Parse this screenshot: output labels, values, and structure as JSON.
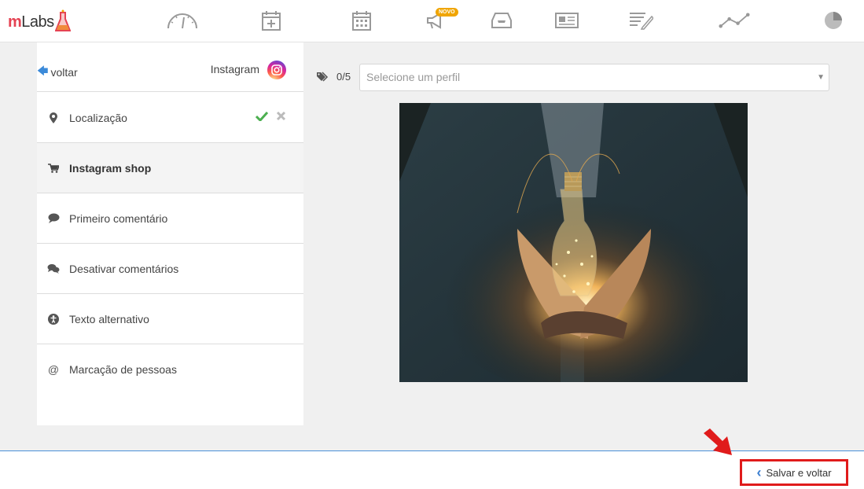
{
  "app": {
    "logo_text": "mLabs"
  },
  "nav": {
    "items": [
      {
        "icon": "speedometer-icon"
      },
      {
        "icon": "calendar-add-icon"
      },
      {
        "icon": "calendar-icon"
      },
      {
        "icon": "megaphone-icon",
        "badge": "NOVO"
      },
      {
        "icon": "inbox-icon"
      },
      {
        "icon": "newspaper-icon"
      },
      {
        "icon": "edit-list-icon"
      },
      {
        "icon": "line-chart-icon"
      },
      {
        "icon": "pie-chart-icon"
      }
    ],
    "badge_color": "#f0a500"
  },
  "panel": {
    "back_label": "voltar",
    "network": "Instagram",
    "items": [
      {
        "label": "Localização",
        "icon": "map-pin-icon"
      },
      {
        "label": "Instagram shop",
        "icon": "cart-icon",
        "active": true
      },
      {
        "label": "Primeiro comentário",
        "icon": "comment-icon"
      },
      {
        "label": "Desativar comentários",
        "icon": "comments-icon"
      },
      {
        "label": "Texto alternativo",
        "icon": "accessibility-icon"
      },
      {
        "label": "Marcação de pessoas",
        "icon": "at-sign-icon",
        "glyph": "@"
      }
    ]
  },
  "tags": {
    "counter": "0/5"
  },
  "profile_select": {
    "placeholder": "Selecione um perfil"
  },
  "footer": {
    "save_label": "Salvar e voltar"
  },
  "colors": {
    "accent": "#3b8ad9",
    "highlight": "#e01b1b",
    "check": "#4caf50"
  }
}
